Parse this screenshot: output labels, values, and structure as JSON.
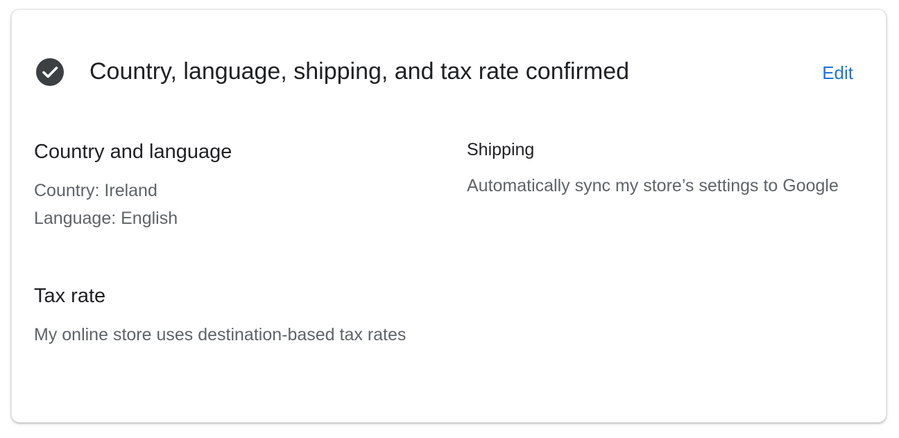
{
  "header": {
    "status_icon": "check-circle-icon",
    "title": "Country, language, shipping, and tax rate confirmed",
    "edit_label": "Edit"
  },
  "country_language": {
    "title": "Country and language",
    "country_line": "Country: Ireland",
    "language_line": "Language: English"
  },
  "shipping": {
    "title": "Shipping",
    "description": "Automatically sync my store’s settings to Google"
  },
  "tax_rate": {
    "title": "Tax rate",
    "description": "My online store uses destination-based tax rates"
  },
  "colors": {
    "accent": "#1a73e8",
    "text_primary": "#202124",
    "text_secondary": "#5f6368",
    "icon": "#3c4043"
  }
}
